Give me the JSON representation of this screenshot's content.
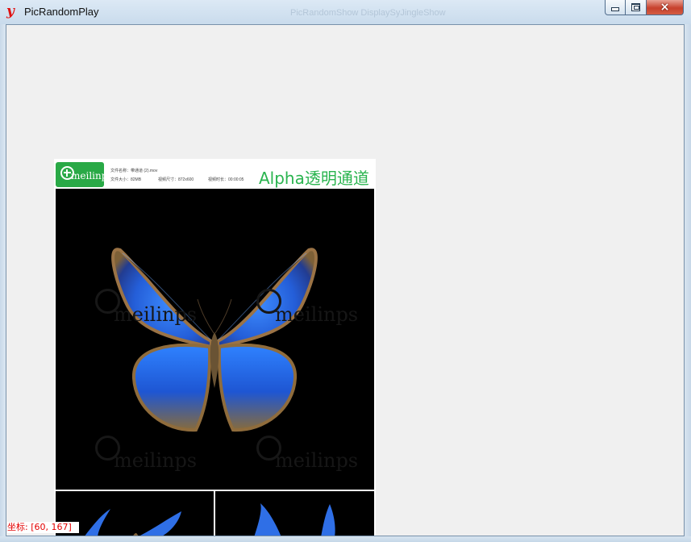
{
  "window": {
    "title": "PicRandomPlay",
    "icon": "app-y-icon",
    "ghost_title": "PicRandomShow DisplaySyJingleShow",
    "buttons": {
      "minimize": "minimize-icon",
      "maximize": "maximize-icon",
      "close": "close-icon"
    }
  },
  "image_preview": {
    "banner": {
      "logo_text": "meilinps",
      "file_name": "文件名称：带通道 (2).mov",
      "file_size": "文件大小：82MB",
      "video_size": "视频尺寸：872x600",
      "duration": "视频时长：00:00:05",
      "headline": "Alpha透明通道"
    },
    "watermarks": [
      "meilinps",
      "meilinps",
      "meilinps",
      "meilinps"
    ],
    "subject": "butterfly"
  },
  "status": {
    "coordinate": "坐标: [60, 167]"
  },
  "colors": {
    "window_frame": "#d5e3ef",
    "client_background": "#f0f0f0",
    "brand_green": "#29a946",
    "title_green": "#2ab44f",
    "coordinate_red": "#e30000",
    "butterfly_blue": "#3e79f2"
  }
}
